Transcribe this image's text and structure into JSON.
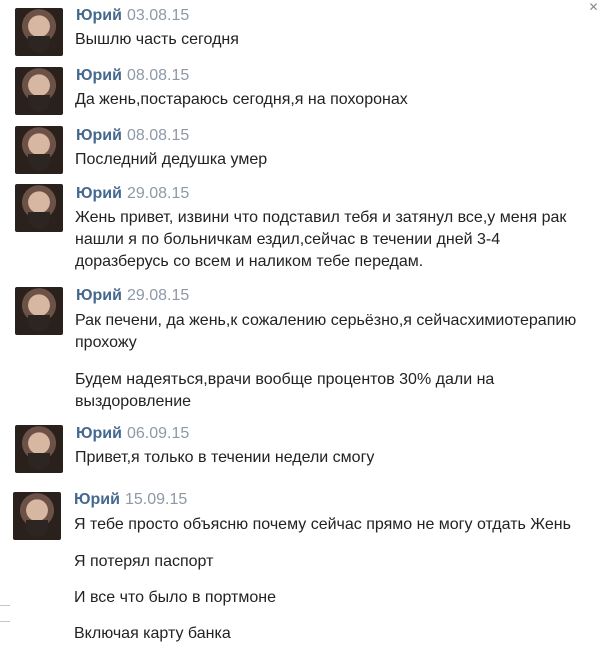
{
  "messages": [
    {
      "author": "Юрий",
      "date": "03.08.15",
      "lines": [
        "Вышлю часть сегодня"
      ]
    },
    {
      "author": "Юрий",
      "date": "08.08.15",
      "lines": [
        "Да жень,постараюсь сегодня,я на похоронах"
      ]
    },
    {
      "author": "Юрий",
      "date": "08.08.15",
      "lines": [
        "Последний дедушка умер"
      ]
    },
    {
      "author": "Юрий",
      "date": "29.08.15",
      "lines": [
        "Жень привет, извини что подставил тебя и затянул все,у меня рак",
        "нашли я по больничкам ездил,сейчас в течении дней 3-4",
        "доразберусь со всем и наликом тебе передам."
      ]
    },
    {
      "author": "Юрий",
      "date": "29.08.15",
      "lines": [
        "Рак печени, да жень,к сожалению серьёзно,я сейчасхимиотерапию",
        "прохожу",
        "Будем надеяться,врачи вообще процентов 30% дали на",
        "выздоровление"
      ]
    },
    {
      "author": "Юрий",
      "date": "06.09.15",
      "lines": [
        "Привет,я только в течении недели смогу"
      ]
    },
    {
      "author": "Юрий",
      "date": "15.09.15",
      "lines": [
        "Я тебе просто объясню почему сейчас прямо не могу отдать Жень",
        "Я потерял паспорт",
        "И все что было в портмоне",
        "Включая карту банка"
      ]
    }
  ],
  "window": {
    "corner_icon": "close-x"
  }
}
